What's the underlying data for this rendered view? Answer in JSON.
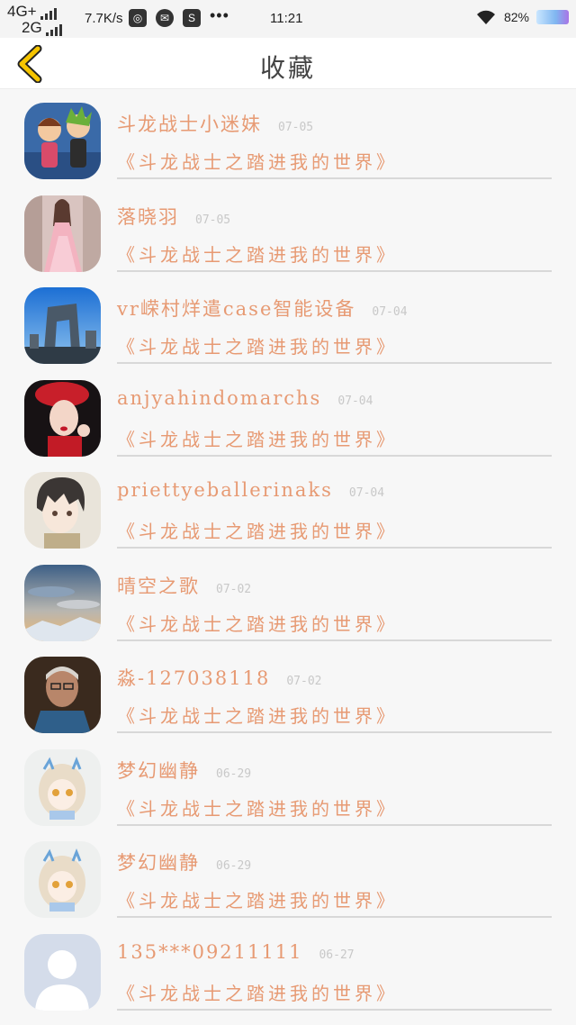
{
  "status_bar": {
    "net_top": "4G+",
    "net_bottom": "2G",
    "speed": "7.7K/s",
    "time": "11:21",
    "battery": "82%",
    "icons": [
      "browser-icon",
      "wechat-icon",
      "s-app-icon",
      "more-dots-icon",
      "wifi-icon"
    ]
  },
  "header": {
    "title": "收藏",
    "back_icon": "chevron-left-icon",
    "back_color": "#f5c400"
  },
  "colors": {
    "accent_text": "#e79a73",
    "date_text": "#c8c8c8"
  },
  "items": [
    {
      "name": "斗龙战士小迷妹",
      "date": "07-05",
      "game": "《斗龙战士之踏进我的世界》",
      "avatar": "cartoon-characters-avatar"
    },
    {
      "name": "落晓羽",
      "date": "07-05",
      "game": "《斗龙战士之踏进我的世界》",
      "avatar": "pink-dress-avatar"
    },
    {
      "name": "vr嵘村烊遣case智能设备",
      "date": "07-04",
      "game": "《斗龙战士之踏进我的世界》",
      "avatar": "building-avatar"
    },
    {
      "name": "anjyahindomarchs",
      "date": "07-04",
      "game": "《斗龙战士之踏进我的世界》",
      "avatar": "red-hat-woman-avatar"
    },
    {
      "name": "priettyeballerinaks",
      "date": "07-04",
      "game": "《斗龙战士之踏进我的世界》",
      "avatar": "anime-boy-avatar"
    },
    {
      "name": "晴空之歌",
      "date": "07-02",
      "game": "《斗龙战士之踏进我的世界》",
      "avatar": "sky-clouds-avatar"
    },
    {
      "name": "淼-127038118",
      "date": "07-02",
      "game": "《斗龙战士之踏进我的世界》",
      "avatar": "old-man-avatar"
    },
    {
      "name": "梦幻幽静",
      "date": "06-29",
      "game": "《斗龙战士之踏进我的世界》",
      "avatar": "anime-girl-avatar"
    },
    {
      "name": "梦幻幽静",
      "date": "06-29",
      "game": "《斗龙战士之踏进我的世界》",
      "avatar": "anime-girl-avatar"
    },
    {
      "name": "135***09211111",
      "date": "06-27",
      "game": "《斗龙战士之踏进我的世界》",
      "avatar": "default-person-avatar"
    }
  ]
}
